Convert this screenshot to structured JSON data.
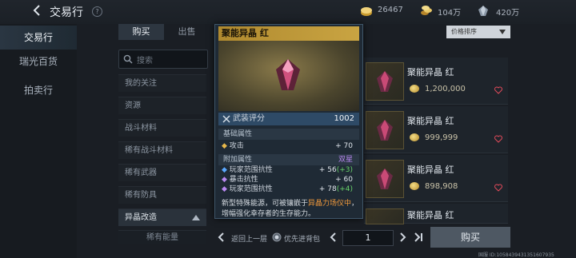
{
  "header": {
    "title": "交易行",
    "help": "?",
    "currencies": [
      {
        "icon": "gold-coin-icon",
        "value": "26467"
      },
      {
        "icon": "coin-stack-icon",
        "value": "104万"
      },
      {
        "icon": "crystal-icon",
        "value": "420万"
      }
    ]
  },
  "sidebar": {
    "items": [
      {
        "label": "交易行"
      },
      {
        "label": "瑞光百货"
      },
      {
        "label": "拍卖行"
      }
    ]
  },
  "market_tabs": {
    "buy": "购买",
    "sell": "出售"
  },
  "search": {
    "placeholder": "搜索"
  },
  "categories": [
    {
      "label": "我的关注"
    },
    {
      "label": "资源"
    },
    {
      "label": "战斗材料"
    },
    {
      "label": "稀有战斗材料"
    },
    {
      "label": "稀有武器"
    },
    {
      "label": "稀有防具"
    },
    {
      "label": "异晶改造"
    },
    {
      "label": "稀有能量"
    }
  ],
  "sort": {
    "label": "价格排序"
  },
  "listings": [
    {
      "name": "聚能异晶 红",
      "price": "1,200,000"
    },
    {
      "name": "聚能异晶 红",
      "price": "999,999"
    },
    {
      "name": "聚能异晶 红",
      "price": "898,908"
    },
    {
      "name": "聚能异晶 红",
      "price": ""
    }
  ],
  "tooltip": {
    "name": "聚能异晶 红",
    "score_label": "武装评分",
    "score": "1002",
    "base_section": "基础属性",
    "base_attrs": [
      {
        "name": "攻击",
        "value": "+ 70"
      }
    ],
    "extra_section": "附加属性",
    "extra_tag": "双星",
    "extra_attrs": [
      {
        "name": "玩家范围抗性",
        "value": "+ 56",
        "bonus": "(+3)"
      },
      {
        "name": "暴击抗性",
        "value": "+ 60",
        "bonus": ""
      },
      {
        "name": "玩家范围抗性",
        "value": "+ 78",
        "bonus": "(+4)"
      }
    ],
    "desc_1": "新型特殊能源，可被镶嵌于",
    "desc_highlight": "异晶力场仪中",
    "desc_2": "，增幅强化幸存者的生存能力。"
  },
  "footer": {
    "back_label": "返回上一层",
    "prefer_label": "优先进背包",
    "page": "1",
    "buy_label": "购买",
    "uid": "国服 ID:1058439431351607935"
  }
}
